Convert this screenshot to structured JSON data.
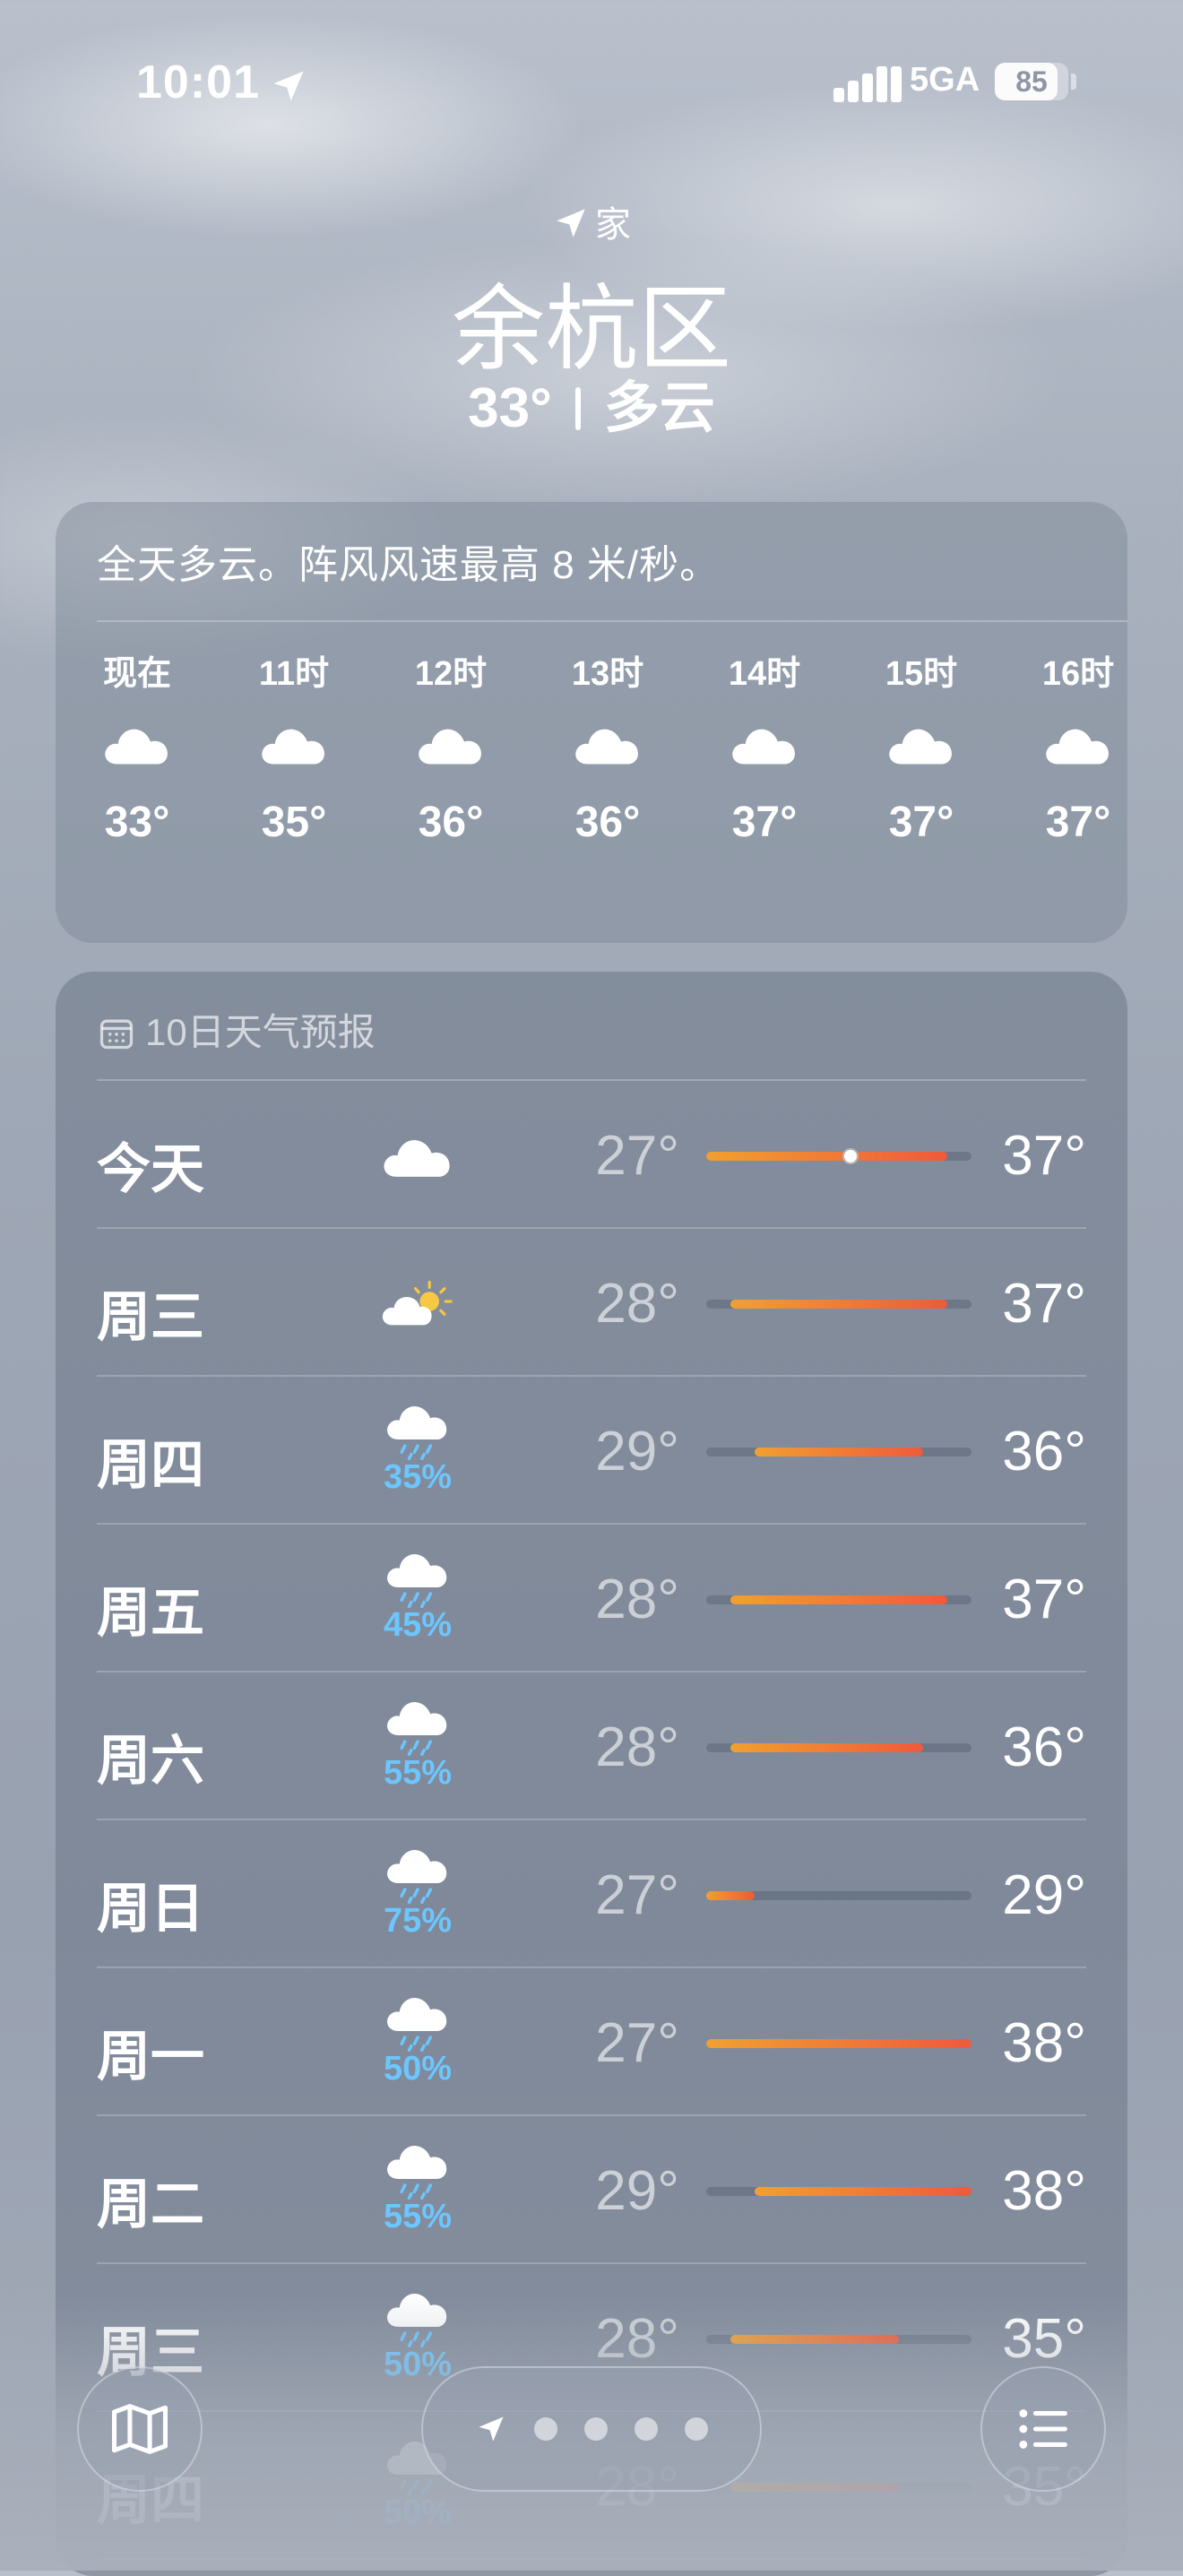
{
  "status_bar": {
    "time": "10:01",
    "network": "5GA",
    "battery": "85",
    "battery_level": 0.85
  },
  "header": {
    "location_label": "家",
    "city": "余杭区",
    "current_temp": "33°",
    "condition": "多云"
  },
  "hourly": {
    "summary": "全天多云。阵风风速最高 8 米/秒。",
    "items": [
      {
        "time": "现在",
        "icon": "cloud-icon",
        "temp": "33°"
      },
      {
        "time": "11时",
        "icon": "cloud-icon",
        "temp": "35°"
      },
      {
        "time": "12时",
        "icon": "cloud-icon",
        "temp": "36°"
      },
      {
        "time": "13时",
        "icon": "cloud-icon",
        "temp": "36°"
      },
      {
        "time": "14时",
        "icon": "cloud-icon",
        "temp": "37°"
      },
      {
        "time": "15时",
        "icon": "cloud-icon",
        "temp": "37°"
      },
      {
        "time": "16时",
        "icon": "cloud-icon",
        "temp": "37°"
      }
    ]
  },
  "daily": {
    "title": "10日天气预报",
    "range_min": 27,
    "range_max": 38,
    "items": [
      {
        "day": "今天",
        "icon": "cloud-icon",
        "pop": "",
        "low": "27°",
        "high": "37°",
        "low_val": 27,
        "high_val": 37,
        "current": 33
      },
      {
        "day": "周三",
        "icon": "partly-sunny-icon",
        "pop": "",
        "low": "28°",
        "high": "37°",
        "low_val": 28,
        "high_val": 37
      },
      {
        "day": "周四",
        "icon": "rain-cloud-icon",
        "pop": "35%",
        "low": "29°",
        "high": "36°",
        "low_val": 29,
        "high_val": 36
      },
      {
        "day": "周五",
        "icon": "rain-cloud-icon",
        "pop": "45%",
        "low": "28°",
        "high": "37°",
        "low_val": 28,
        "high_val": 37
      },
      {
        "day": "周六",
        "icon": "rain-cloud-icon",
        "pop": "55%",
        "low": "28°",
        "high": "36°",
        "low_val": 28,
        "high_val": 36
      },
      {
        "day": "周日",
        "icon": "rain-cloud-icon",
        "pop": "75%",
        "low": "27°",
        "high": "29°",
        "low_val": 27,
        "high_val": 29
      },
      {
        "day": "周一",
        "icon": "rain-cloud-icon",
        "pop": "50%",
        "low": "27°",
        "high": "38°",
        "low_val": 27,
        "high_val": 38
      },
      {
        "day": "周二",
        "icon": "rain-cloud-icon",
        "pop": "55%",
        "low": "29°",
        "high": "38°",
        "low_val": 29,
        "high_val": 38
      },
      {
        "day": "周三",
        "icon": "rain-cloud-icon",
        "pop": "50%",
        "low": "28°",
        "high": "35°",
        "low_val": 28,
        "high_val": 35
      },
      {
        "day": "周四",
        "icon": "rain-cloud-icon",
        "pop": "50%",
        "low": "28°",
        "high": "35°",
        "low_val": 28,
        "high_val": 35
      }
    ]
  },
  "bottom_bar": {
    "map_icon": "map-icon",
    "list_icon": "list-icon",
    "page_count": 5,
    "current_page": 0
  }
}
